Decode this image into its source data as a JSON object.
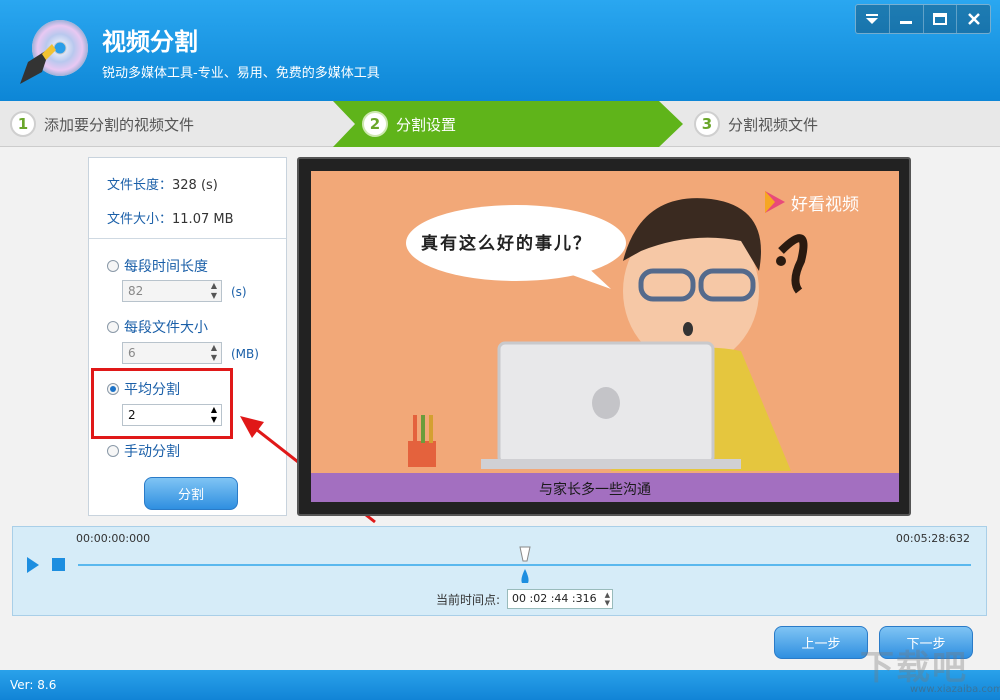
{
  "header": {
    "title": "视频分割",
    "subtitle": "锐动多媒体工具-专业、易用、免费的多媒体工具"
  },
  "steps": [
    {
      "num": "1",
      "label": "添加要分割的视频文件"
    },
    {
      "num": "2",
      "label": "分割设置"
    },
    {
      "num": "3",
      "label": "分割视频文件"
    }
  ],
  "file_info": {
    "length_label": "文件长度：",
    "length_value": "328 (s)",
    "size_label": "文件大小：",
    "size_value": "11.07 MB"
  },
  "options": {
    "per_time_label": "每段时间长度",
    "per_time_value": "82",
    "per_time_unit": "(s)",
    "per_size_label": "每段文件大小",
    "per_size_value": "6",
    "per_size_unit": "(MB)",
    "average_label": "平均分割",
    "average_value": "2",
    "manual_label": "手动分割",
    "selected": "average"
  },
  "split_button": "分割",
  "video": {
    "bubble_text": "真有这么好的事儿？",
    "caption": "与家长多一些沟通",
    "brand": "好看视频"
  },
  "timeline": {
    "start": "00:00:00:000",
    "end": "00:05:28:632",
    "current_label": "当前时间点:",
    "current_value": "00 :02 :44 :316",
    "progress": 0.5
  },
  "nav": {
    "prev": "上一步",
    "next": "下一步"
  },
  "version": "Ver: 8.6",
  "watermark": {
    "main": "下载吧",
    "site": "www.xiazaiba.com"
  },
  "colors": {
    "accent": "#1a86d8",
    "step_active": "#64b31e",
    "highlight": "#e01818"
  }
}
